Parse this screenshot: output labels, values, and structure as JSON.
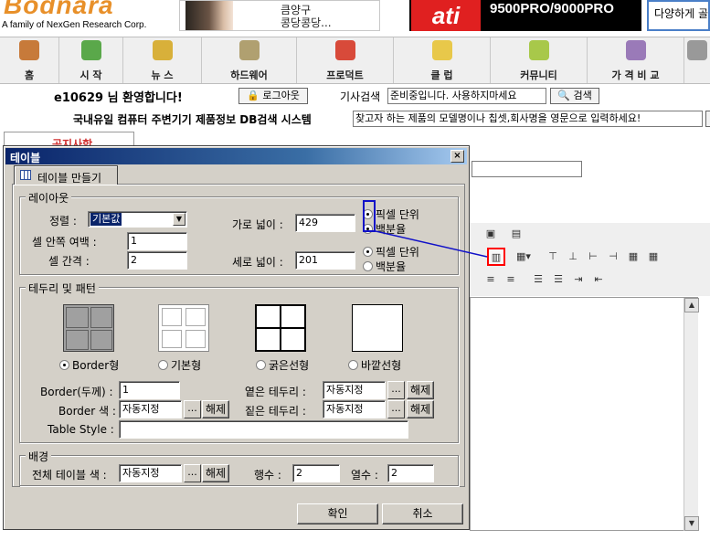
{
  "header": {
    "logo_text": "Bodnara",
    "logo_subtitle": "A family of NexGen Research Corp.",
    "ad1_lines": [
      "큼양구",
      "콩당콩당..."
    ],
    "ad2_brand": "ati",
    "ad2_text": "9500PRO/9000PRO",
    "ad3_text": "다양하게 골"
  },
  "nav": {
    "items": [
      {
        "label": "홈",
        "icon": "house-icon",
        "color": "#c77a3a"
      },
      {
        "label": "시 작",
        "icon": "plant-icon",
        "color": "#5aa84a"
      },
      {
        "label": "뉴 스",
        "icon": "pencil-icon",
        "color": "#d8b03a"
      },
      {
        "label": "하드웨어",
        "icon": "cd-icon",
        "color": "#b0a070"
      },
      {
        "label": "프로덕트",
        "icon": "gift-icon",
        "color": "#d84a3a"
      },
      {
        "label": "클 럽",
        "icon": "note-icon",
        "color": "#e8c84a"
      },
      {
        "label": "커뮤니티",
        "icon": "write-icon",
        "color": "#a8c84a"
      },
      {
        "label": "가 격 비 교",
        "icon": "box-icon",
        "color": "#9a7ab8"
      },
      {
        "label": "",
        "icon": "more-icon",
        "color": "#999999"
      }
    ]
  },
  "welcome": {
    "text": "e10629 님 환영합니다!",
    "logout_label": "로그아웃"
  },
  "article_search": {
    "label": "기사검색",
    "value": "준비중입니다. 사용하지마세요",
    "button_label": "검색"
  },
  "db_search": {
    "label": "국내유일 컴퓨터 주변기기 제품정보 DB검색 시스템",
    "placeholder": "찾고자 하는 제품의 모델명이나 칩셋,회사명을 영문으로 입력하세요!"
  },
  "side_menu": {
    "label": "공지사항"
  },
  "dialog": {
    "title": "테이블",
    "close_label": "×",
    "tab_label": "테이블 만들기",
    "layout": {
      "group_label": "레이아웃",
      "align_label": "정렬 :",
      "align_value": "기본값",
      "padding_label": "셀 안쪽 여백 :",
      "padding_value": "1",
      "spacing_label": "셀 간격 :",
      "spacing_value": "2",
      "width_label": "가로 넓이 :",
      "width_value": "429",
      "width_unit_px": "픽셀 단위",
      "width_unit_pct": "백분율",
      "height_label": "세로 넓이 :",
      "height_value": "201",
      "height_unit_px": "픽셀 단위",
      "height_unit_pct": "백분율"
    },
    "border_pattern": {
      "group_label": "테두리 및 패턴",
      "options": [
        "Border형",
        "기본형",
        "굵은선형",
        "바깥선형"
      ],
      "selected": "Border형",
      "border_width_label": "Border(두께) :",
      "border_width_value": "1",
      "border_color_label": "Border 색 :",
      "border_color_value": "자동지정",
      "light_border_label": "옅은 테두리 :",
      "light_border_value": "자동지정",
      "dark_border_label": "짙은 테두리 :",
      "dark_border_value": "자동지정",
      "table_style_label": "Table Style :",
      "table_style_value": "",
      "picker_label": "...",
      "clear_label": "해제"
    },
    "background": {
      "group_label": "배경",
      "table_color_label": "전체 테이블 색 :",
      "table_color_value": "자동지정",
      "rows_label": "행수 :",
      "rows_value": "2",
      "cols_label": "열수 :",
      "cols_value": "2",
      "picker_label": "...",
      "clear_label": "해제"
    },
    "ok_label": "확인",
    "cancel_label": "취소"
  },
  "editor_toolbar": {
    "icons": [
      "paste-icon",
      "special-icon",
      "table-icon",
      "table-dropdown-icon",
      "insert-row-above-icon",
      "insert-row-below-icon",
      "insert-col-icon",
      "delete-col-icon",
      "merge-cells-icon",
      "split-cells-icon",
      "align-center-icon",
      "align-right-icon",
      "ordered-list-icon",
      "unordered-list-icon",
      "indent-icon",
      "outdent-icon"
    ]
  }
}
